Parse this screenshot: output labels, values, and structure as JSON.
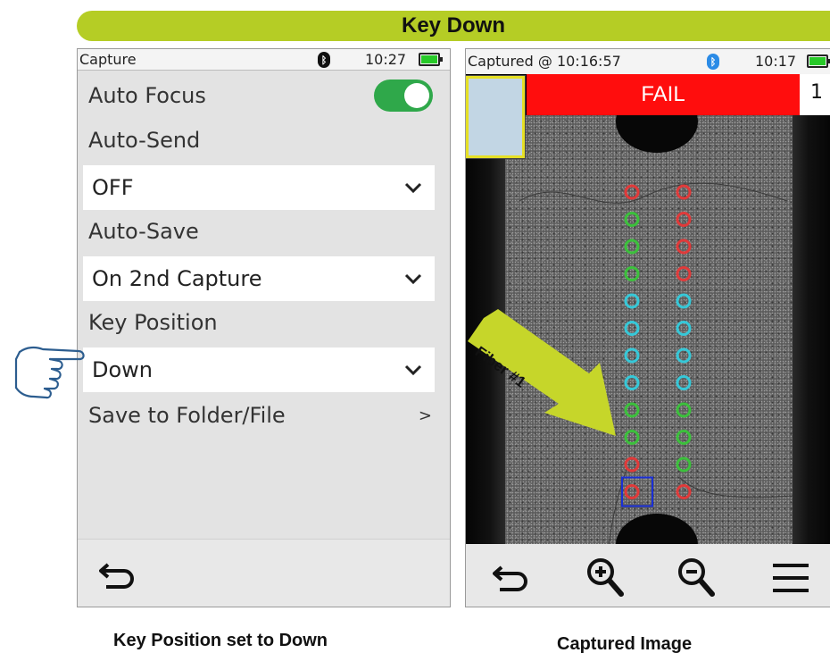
{
  "banner": {
    "title": "Key Down"
  },
  "left_screen": {
    "status": {
      "title": "Capture",
      "time": "10:27"
    },
    "settings": {
      "auto_focus_label": "Auto Focus",
      "auto_focus_on": true,
      "auto_send_label": "Auto-Send",
      "auto_send_value": "OFF",
      "auto_save_label": "Auto-Save",
      "auto_save_value": "On 2nd Capture",
      "key_position_label": "Key Position",
      "key_position_value": "Down",
      "save_to_label": "Save to Folder/File",
      "save_to_arrow": ">"
    },
    "toolbar": {
      "back_icon": "back-arrow-icon"
    }
  },
  "right_screen": {
    "status": {
      "title": "Captured @ 10:16:57",
      "time": "10:17"
    },
    "result": {
      "label": "FAIL",
      "side_value": "1"
    },
    "callout": {
      "text": "Fiber #1"
    },
    "fibers": {
      "left_column": [
        "red",
        "green",
        "green",
        "green",
        "cyan",
        "cyan",
        "cyan",
        "cyan",
        "green",
        "green",
        "red",
        "red"
      ],
      "right_column": [
        "red",
        "red",
        "red",
        "red",
        "cyan",
        "cyan",
        "cyan",
        "cyan",
        "green",
        "green",
        "green",
        "red"
      ]
    },
    "toolbar": {
      "icons": [
        "back-arrow-icon",
        "zoom-in-icon",
        "zoom-out-icon",
        "menu-icon"
      ]
    }
  },
  "captions": {
    "left": "Key Position set to Down",
    "right": "Captured Image"
  },
  "colors": {
    "banner": "#b5cd25",
    "fail": "#ff0d0d",
    "toggle": "#2fa84a",
    "battery": "#27c928",
    "bluetooth": "#2b8be6",
    "fiber_red": "#e03a3a",
    "fiber_green": "#3cc03c",
    "fiber_cyan": "#36c8d8",
    "highlight_box": "#1a2fd6"
  }
}
